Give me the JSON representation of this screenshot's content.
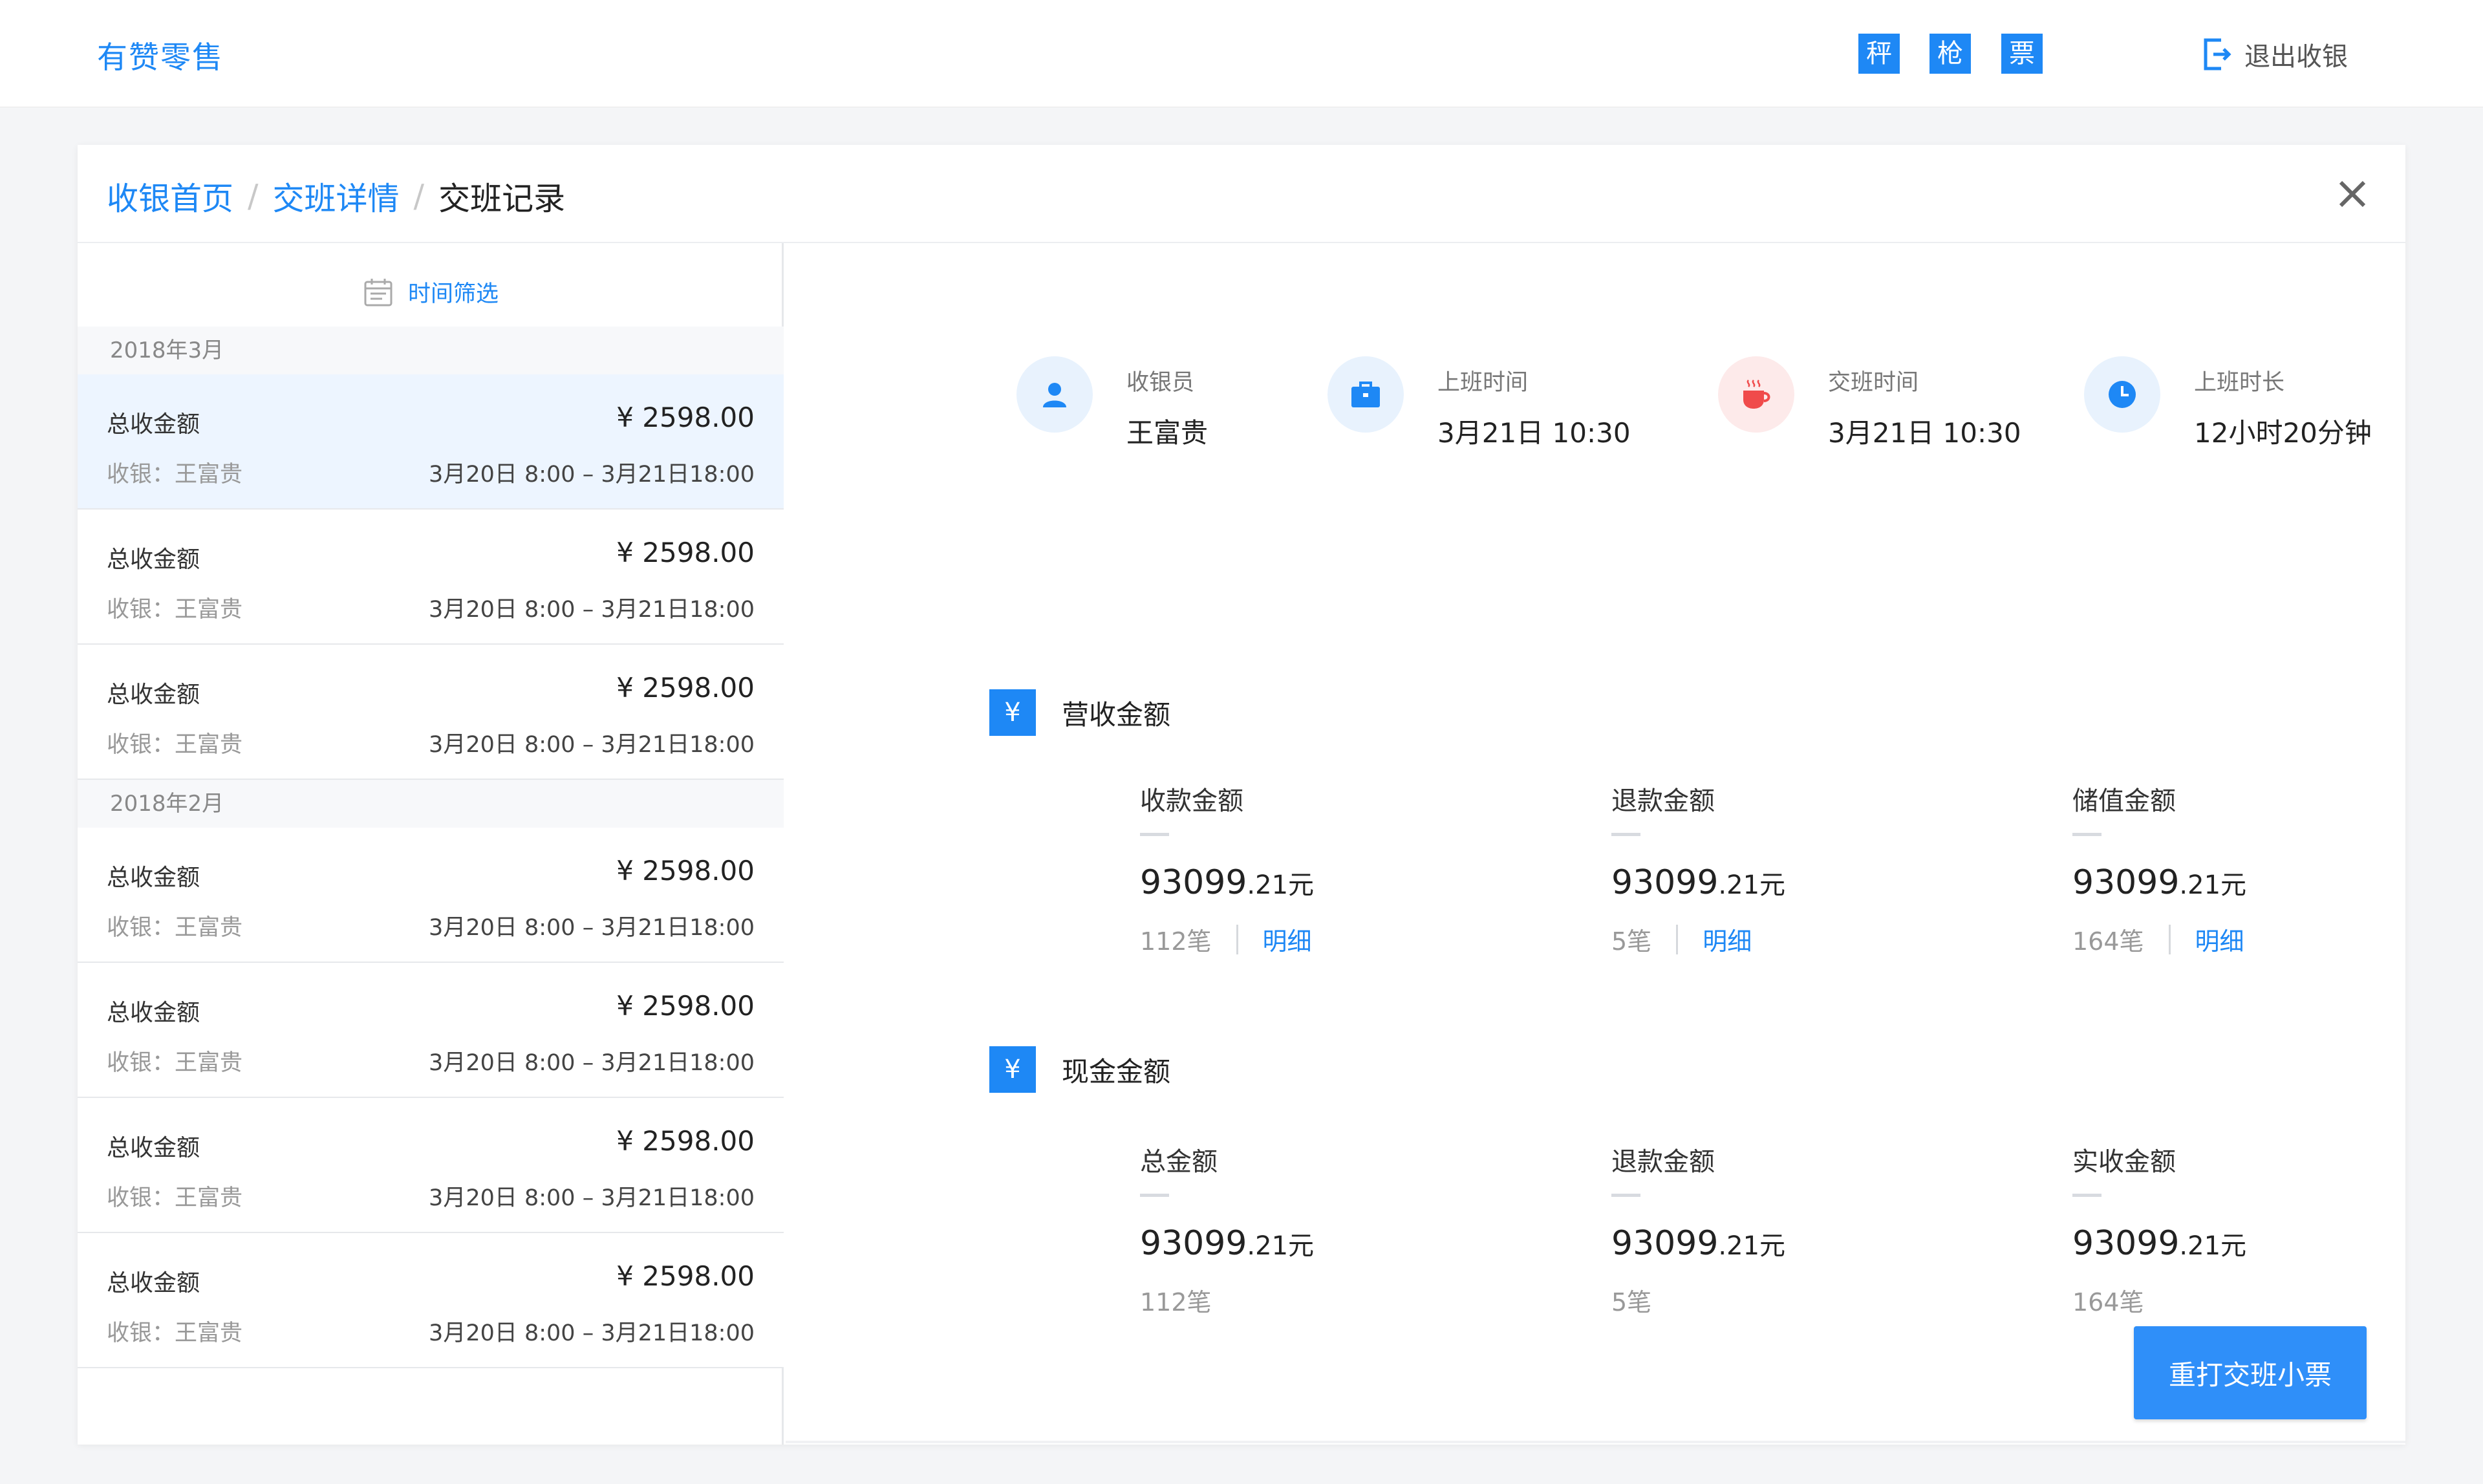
{
  "topbar": {
    "brand": "有赞零售",
    "buttons": [
      "秤",
      "枪",
      "票"
    ],
    "logout_label": "退出收银"
  },
  "breadcrumb": [
    "收银首页",
    "交班详情",
    "交班记录"
  ],
  "left": {
    "filter_label": "时间筛选",
    "months": [
      "2018年3月",
      "2018年2月"
    ],
    "item": {
      "title": "总收金额",
      "amount": "¥ 2598.00",
      "cashier": "收银：王富贵",
      "range": "3月20日 8:00 – 3月21日18:00"
    }
  },
  "summary": {
    "cashier_label": "收银员",
    "cashier_value": "王富贵",
    "start_label": "上班时间",
    "start_value": "3月21日 10:30",
    "handover_label": "交班时间",
    "handover_value": "3月21日 10:30",
    "duration_label": "上班时长",
    "duration_value": "12小时20分钟"
  },
  "revenue": {
    "title": "营收金额",
    "icon": "¥",
    "metrics": [
      {
        "label": "收款金额",
        "int": "93099",
        "dec": ".21元",
        "count": "112笔",
        "link": "明细"
      },
      {
        "label": "退款金额",
        "int": "93099",
        "dec": ".21元",
        "count": "5笔",
        "link": "明细"
      },
      {
        "label": "储值金额",
        "int": "93099",
        "dec": ".21元",
        "count": "164笔",
        "link": "明细"
      }
    ]
  },
  "cash": {
    "title": "现金金额",
    "icon": "¥",
    "metrics": [
      {
        "label": "总金额",
        "int": "93099",
        "dec": ".21元",
        "count": "112笔"
      },
      {
        "label": "退款金额",
        "int": "93099",
        "dec": ".21元",
        "count": "5笔"
      },
      {
        "label": "实收金额",
        "int": "93099",
        "dec": ".21元",
        "count": "164笔"
      }
    ]
  },
  "reprint_button": "重打交班小票",
  "colors": {
    "accent": "#1e88f5",
    "button": "#2f8ff9",
    "selected_bg": "#edf5ff"
  }
}
